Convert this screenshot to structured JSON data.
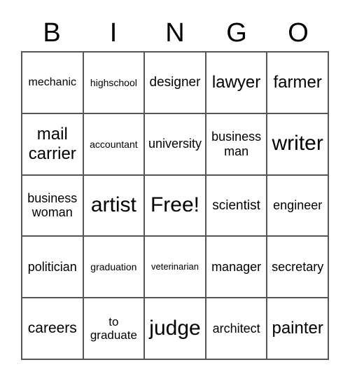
{
  "header": [
    "B",
    "I",
    "N",
    "G",
    "O"
  ],
  "cells": [
    [
      "mechanic",
      "highschool",
      "designer",
      "lawyer",
      "farmer"
    ],
    [
      "mail carrier",
      "accountant",
      "university",
      "business man",
      "writer"
    ],
    [
      "business woman",
      "artist",
      "Free!",
      "scientist",
      "engineer"
    ],
    [
      "politician",
      "graduation",
      "veterinarian",
      "manager",
      "secretary"
    ],
    [
      "careers",
      "to graduate",
      "judge",
      "architect",
      "painter"
    ]
  ]
}
